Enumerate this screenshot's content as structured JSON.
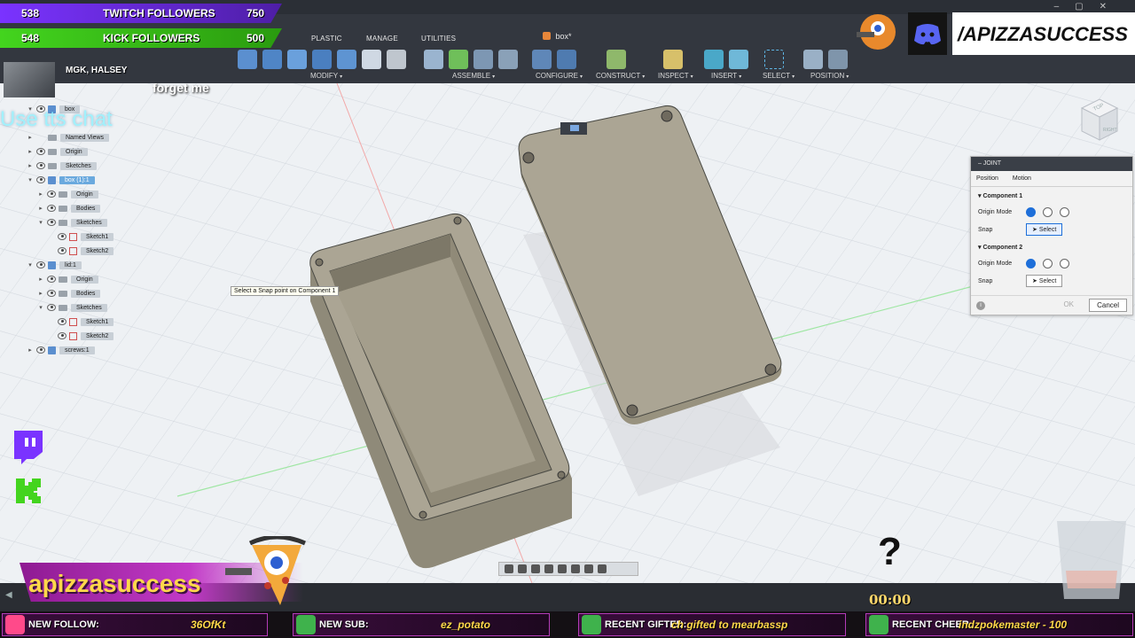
{
  "app": {
    "document_title": "box*",
    "ribbon_tabs": [
      "PLASTIC",
      "MANAGE",
      "UTILITIES"
    ],
    "groups": [
      {
        "label": "MODIFY"
      },
      {
        "label": "ASSEMBLE"
      },
      {
        "label": "CONFIGURE"
      },
      {
        "label": "CONSTRUCT"
      },
      {
        "label": "INSPECT"
      },
      {
        "label": "INSERT"
      },
      {
        "label": "SELECT"
      },
      {
        "label": "POSITION"
      }
    ]
  },
  "browser": {
    "rows": [
      {
        "label": "box",
        "kind": "comp",
        "expander": "▾"
      },
      {
        "label": "Named Views",
        "kind": "folder",
        "expander": "▸"
      },
      {
        "label": "Origin",
        "kind": "folder",
        "expander": "▸"
      },
      {
        "label": "Sketches",
        "kind": "folder",
        "expander": "▸"
      },
      {
        "label": "box (1):1",
        "kind": "comp",
        "expander": "▾",
        "selected": true
      },
      {
        "label": "Origin",
        "kind": "folder",
        "expander": "▸"
      },
      {
        "label": "Bodies",
        "kind": "folder",
        "expander": "▸"
      },
      {
        "label": "Sketches",
        "kind": "folder",
        "expander": "▾"
      },
      {
        "label": "Sketch1",
        "kind": "sketch",
        "expander": ""
      },
      {
        "label": "Sketch2",
        "kind": "sketch",
        "expander": ""
      },
      {
        "label": "lid:1",
        "kind": "comp",
        "expander": "▾"
      },
      {
        "label": "Origin",
        "kind": "folder",
        "expander": "▸"
      },
      {
        "label": "Bodies",
        "kind": "folder",
        "expander": "▸"
      },
      {
        "label": "Sketches",
        "kind": "folder",
        "expander": "▾"
      },
      {
        "label": "Sketch1",
        "kind": "sketch",
        "expander": ""
      },
      {
        "label": "Sketch2",
        "kind": "sketch",
        "expander": ""
      },
      {
        "label": "screws:1",
        "kind": "comp",
        "expander": "▸"
      }
    ]
  },
  "tooltip": "Select a Snap point on Component 1",
  "joint_panel": {
    "title": "JOINT",
    "tabs": [
      "Position",
      "Motion"
    ],
    "component1": {
      "title": "Component 1",
      "origin_mode_label": "Origin Mode",
      "snap_label": "Snap",
      "select_label": "Select"
    },
    "component2": {
      "title": "Component 2",
      "origin_mode_label": "Origin Mode",
      "snap_label": "Snap",
      "select_label": "Select"
    },
    "ok_label": "OK",
    "cancel_label": "Cancel"
  },
  "viewcube": {
    "top": "TOP",
    "right": "RIGHT"
  },
  "overlay": {
    "twitch_followers": {
      "current": "538",
      "label": "TWITCH FOLLOWERS",
      "goal": "750",
      "color": "#7a33ff"
    },
    "kick_followers": {
      "current": "548",
      "label": "KICK FOLLOWERS",
      "goal": "500",
      "color": "#43d41e"
    },
    "music": {
      "artist": "MGK, HALSEY",
      "song": "forget me"
    },
    "tts": "Use tts chat",
    "discord": "/APIZZASUCCESS",
    "brand_name": "apizzasuccess",
    "question_mark": "?",
    "timer": "00:00",
    "ticker": [
      {
        "label": "NEW FOLLOW:",
        "value": "36OfKt"
      },
      {
        "label": "NEW SUB:",
        "value": "ez_potato"
      },
      {
        "label": "RECENT GIFTED:",
        "value": "ch gifted to mearbassp"
      },
      {
        "label": "RECENT CHEER:",
        "value": "indzpokemaster - 100"
      }
    ]
  },
  "colors": {
    "accent": "#1e6fd9",
    "model_fill": "#a8a191",
    "toolbar": "#33373f",
    "overlay_purple": "#b43bb8"
  }
}
